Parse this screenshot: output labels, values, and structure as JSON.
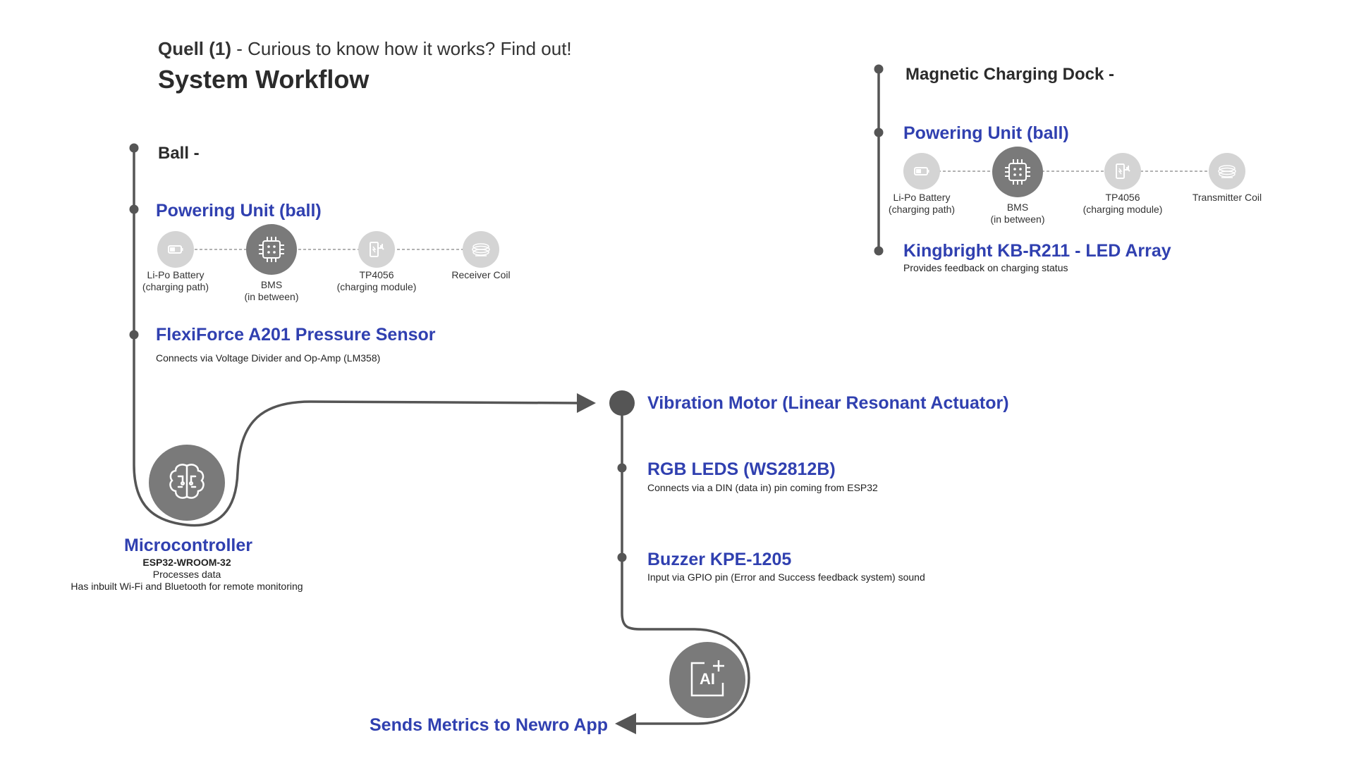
{
  "header": {
    "brand": "Quell (1)",
    "tagline": " - Curious to know how it works?  Find out!",
    "title": "System Workflow"
  },
  "ball": {
    "label": "Ball -",
    "powering_title": "Powering Unit (ball)",
    "chain": [
      {
        "icon": "battery-icon",
        "caption_line1": "Li-Po Battery",
        "caption_line2": "(charging path)"
      },
      {
        "icon": "chip-icon",
        "caption_line1": "BMS",
        "caption_line2": "(in between)"
      },
      {
        "icon": "charging-module-icon",
        "caption_line1": "TP4056",
        "caption_line2": "(charging module)"
      },
      {
        "icon": "coil-icon",
        "caption_line1": "Receiver Coil",
        "caption_line2": ""
      }
    ],
    "sensor_title": "FlexiForce A201 Pressure Sensor",
    "sensor_desc": "Connects via Voltage Divider and Op-Amp (LM358)"
  },
  "microcontroller": {
    "title": "Microcontroller",
    "model": "ESP32-WROOM-32",
    "line1": "Processes data",
    "line2": "Has inbuilt Wi-Fi and Bluetooth for remote monitoring"
  },
  "outputs": {
    "motor_title": "Vibration Motor (Linear Resonant Actuator)",
    "rgb_title": "RGB LEDS (WS2812B)",
    "rgb_desc": "Connects via a DIN (data in) pin coming from ESP32",
    "buzzer_title": "Buzzer KPE-1205",
    "buzzer_desc": "Input via GPIO pin (Error and Success feedback system) sound",
    "ai_icon_text": "AI",
    "final_label": "Sends Metrics to Newro App"
  },
  "dock": {
    "label": "Magnetic Charging Dock -",
    "powering_title": "Powering Unit (ball)",
    "chain": [
      {
        "icon": "battery-icon",
        "caption_line1": "Li-Po Battery",
        "caption_line2": "(charging path)"
      },
      {
        "icon": "chip-icon",
        "caption_line1": "BMS",
        "caption_line2": "(in between)"
      },
      {
        "icon": "charging-module-icon",
        "caption_line1": "TP4056",
        "caption_line2": "(charging module)"
      },
      {
        "icon": "coil-icon",
        "caption_line1": "Transmitter Coil",
        "caption_line2": ""
      }
    ],
    "led_title": "Kingbright KB-R211 - LED Array",
    "led_desc": "Provides feedback on charging status"
  },
  "colors": {
    "accent": "#3040b0",
    "line": "#555555",
    "node_dark": "#7a7a7a",
    "node_light": "#d4d4d4"
  }
}
